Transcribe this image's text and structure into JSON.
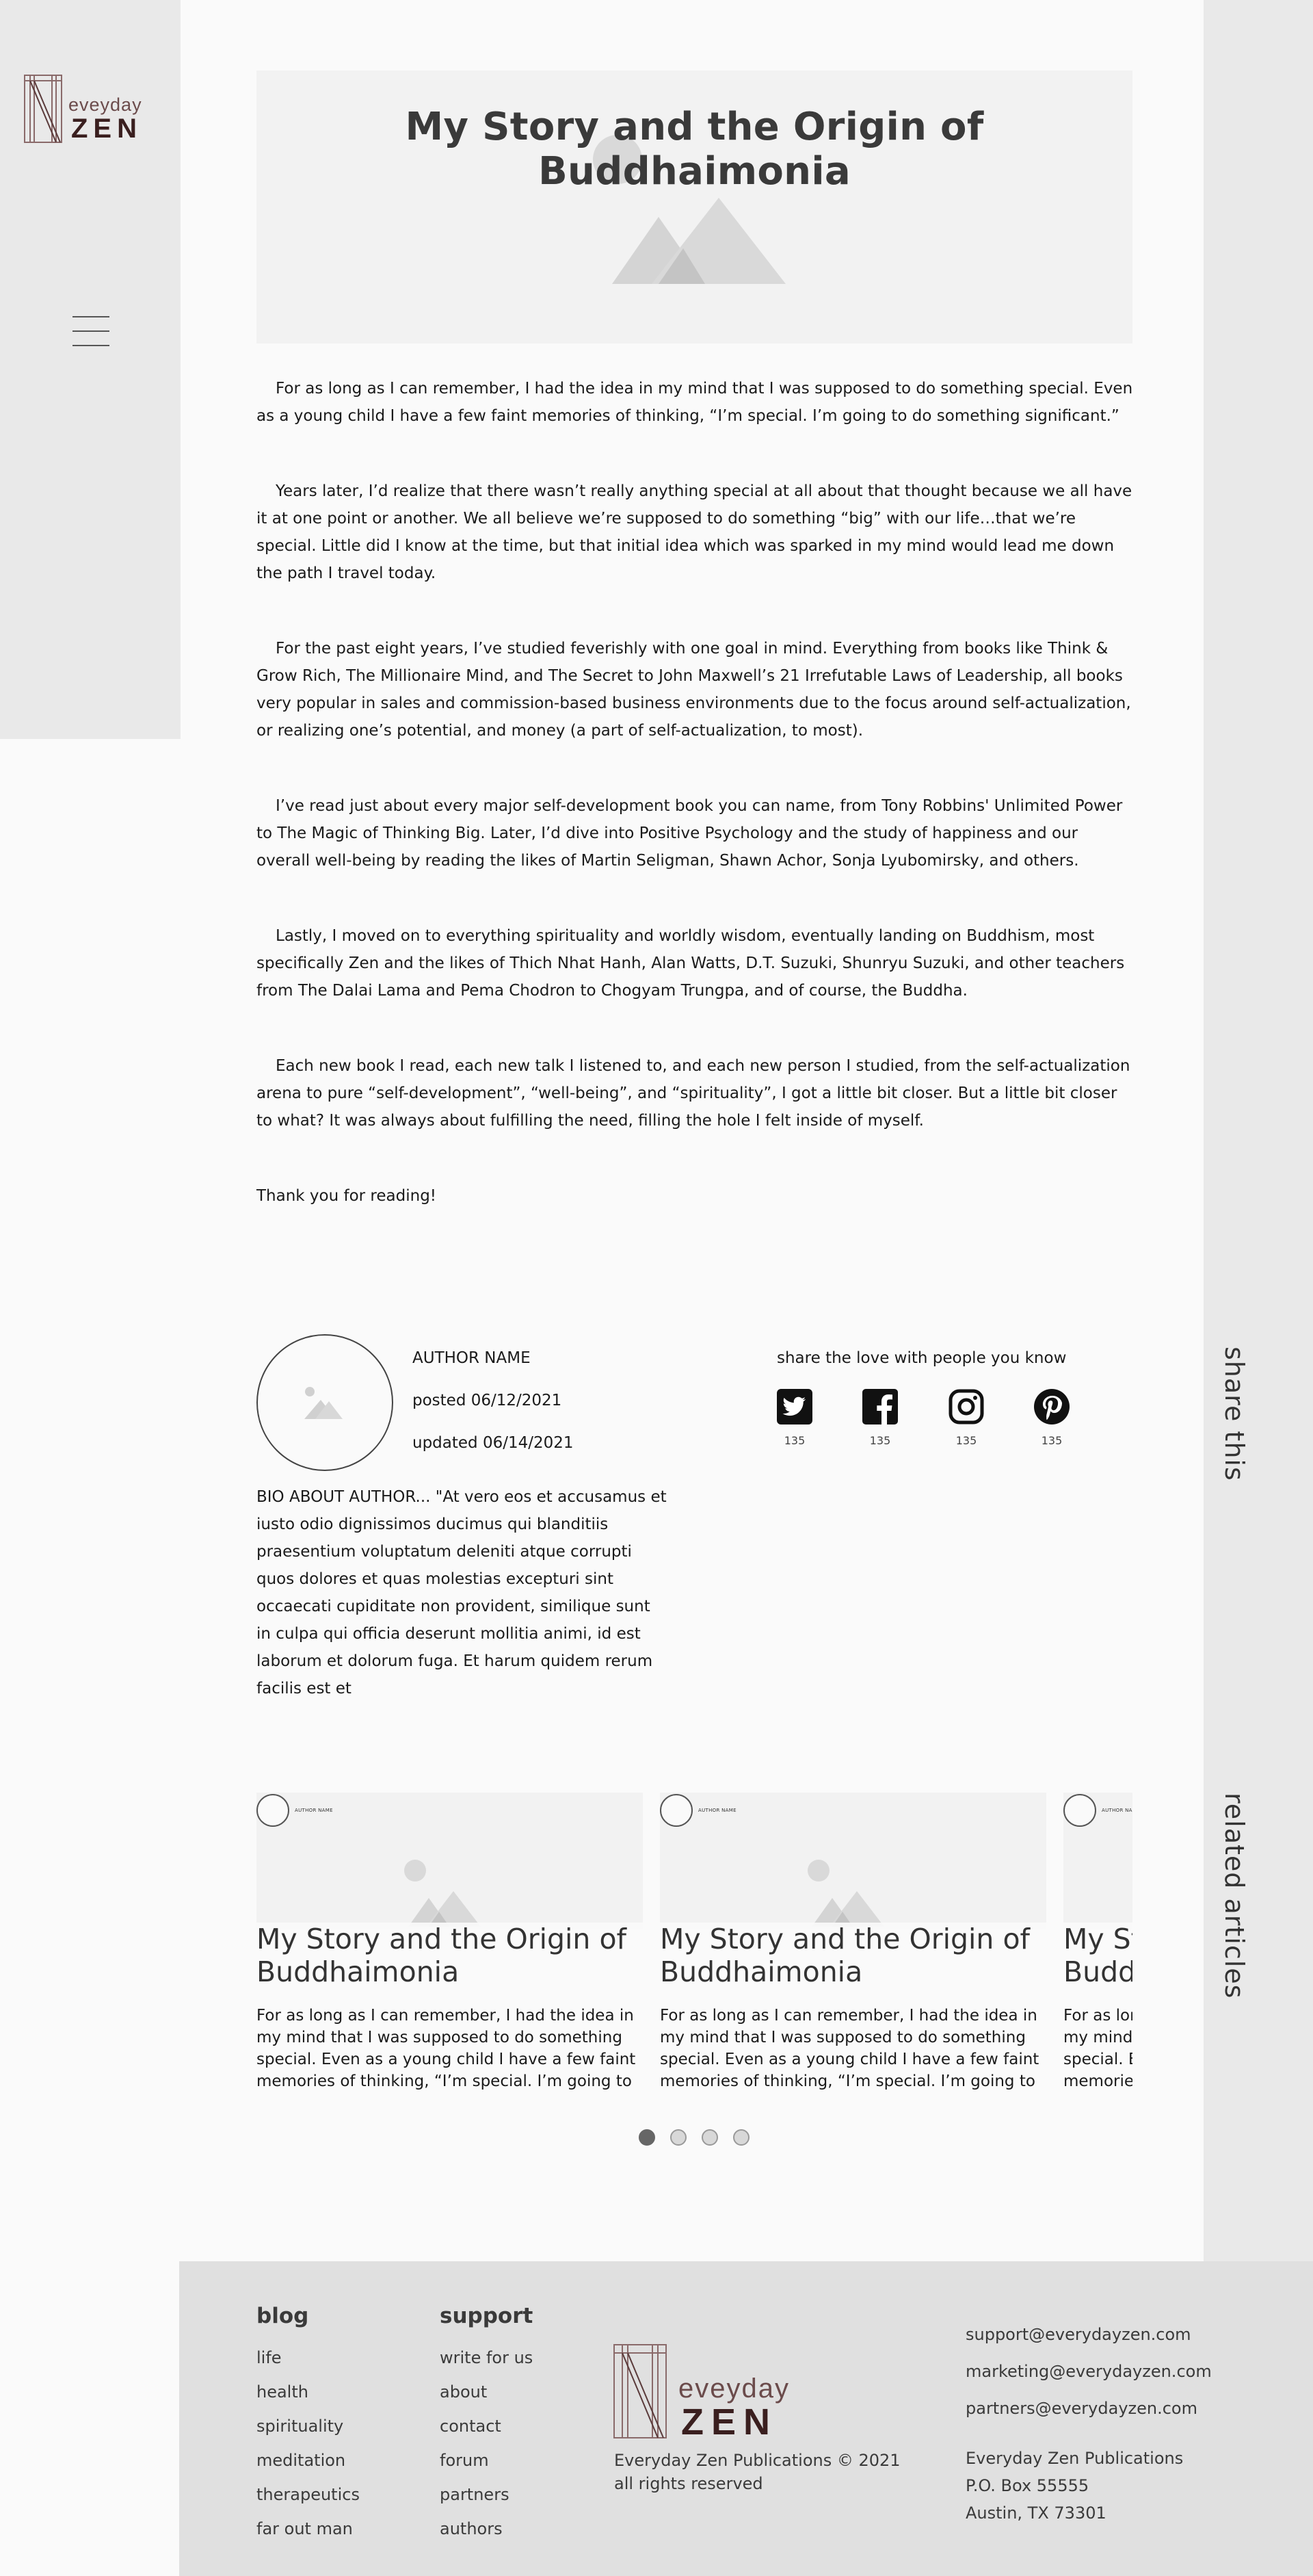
{
  "brand": {
    "logo_top": "eveyday",
    "logo_bottom": "ZEN"
  },
  "nav": {
    "menu_icon": "hamburger-icon"
  },
  "rail": {
    "share_label": "share this",
    "related_label": "related articles"
  },
  "article": {
    "title": "My Story and the Origin of Buddhaimonia",
    "paragraphs": [
      "For as long as I can remember, I had the idea in my mind that I was supposed to do something special. Even as a young child I have a few faint memories of thinking, “I’m special. I’m going to do something significant.”",
      "Years later, I’d realize that there wasn’t really anything special at all about that thought because we all have it at one point or another. We all believe we’re supposed to do something “big” with our life…that we’re special. Little did I know at the time, but that initial idea which was sparked in my mind would lead me down the path I travel today.",
      "For the past eight years, I’ve studied feverishly with one goal in mind. Everything from books like Think & Grow Rich, The Millionaire Mind, and The Secret to John Maxwell’s 21 Irrefutable Laws of Leadership, all books very popular in sales and commission-based business environments due to the focus around self-actualization, or realizing one’s potential, and money (a part of self-actualization, to most).",
      "I’ve read just about every major self-development book you can name, from Tony Robbins' Unlimited Power to The Magic of Thinking Big. Later, I’d dive into Positive Psychology and the study of happiness and our overall well-being by reading the likes of Martin Seligman, Shawn Achor, Sonja Lyubomirsky, and others.",
      "Lastly, I moved on to everything spirituality and worldly wisdom, eventually landing on Buddhism, most specifically Zen and the likes of Thich Nhat Hanh, Alan Watts, D.T. Suzuki, Shunryu Suzuki, and other teachers from The Dalai Lama and Pema Chodron to Chogyam Trungpa, and of course, the Buddha.",
      "Each new book I read, each new talk I listened to, and each new person I studied, from the self-actualization arena to pure “self-development”, “well-being”, and “spirituality”, I got a little bit closer. But a little bit closer to what? It was always about fulfilling the need, filling the hole I felt inside of myself."
    ],
    "closing": "Thank you for reading!"
  },
  "author": {
    "name": "AUTHOR NAME",
    "posted": "posted 06/12/2021",
    "updated": "updated 06/14/2021",
    "bio": "BIO ABOUT AUTHOR... \"At vero eos et accusamus et iusto odio dignissimos ducimus qui blanditiis praesentium voluptatum deleniti atque corrupti quos dolores et quas molestias excepturi sint occaecati cupiditate non provident, similique sunt in culpa qui officia deserunt mollitia animi, id est laborum et dolorum fuga. Et harum quidem rerum facilis est et"
  },
  "share": {
    "title": "share the love with people you know",
    "items": [
      {
        "icon": "twitter-icon",
        "count": "135"
      },
      {
        "icon": "facebook-icon",
        "count": "135"
      },
      {
        "icon": "instagram-icon",
        "count": "135"
      },
      {
        "icon": "pinterest-icon",
        "count": "135"
      }
    ]
  },
  "related": {
    "cards": [
      {
        "author": "AUTHOR NAME",
        "title": "My Story and the Origin of Buddhaimonia",
        "excerpt": "For as long as I can remember, I had the idea in my mind that I was supposed to do something special. Even as a young child I have a few faint memories of thinking, “I’m special. I’m going to"
      },
      {
        "author": "AUTHOR NAME",
        "title": "My Story and the Origin of Buddhaimonia",
        "excerpt": "For as long as I can remember, I had the idea in my mind that I was supposed to do something special. Even as a young child I have a few faint memories of thinking, “I’m special. I’m going to"
      },
      {
        "author": "AUTHOR NAME",
        "title": "My Story and the Origin of Buddhaimonia",
        "excerpt": "For as long as I can remember, I had the idea in my mind that I was supposed to do something special. Even as a young child I have a few faint memories of thinking, “I’m special. I’m going to"
      }
    ],
    "active_dot": 1,
    "dot_count": 4
  },
  "footer": {
    "blog": {
      "heading": "blog",
      "links": [
        "life",
        "health",
        "spirituality",
        "meditation",
        "therapeutics",
        "far out man"
      ]
    },
    "support": {
      "heading": "support",
      "links": [
        "write for us",
        "about",
        "contact",
        "forum",
        "partners",
        "authors"
      ]
    },
    "copyright": "Everyday Zen Publications © 2021",
    "rights": "all rights reserved",
    "emails": [
      "support@everydayzen.com",
      "marketing@everydayzen.com",
      "partners@everydayzen.com"
    ],
    "address": [
      "Everyday Zen Publications",
      "P.O. Box 55555",
      "Austin, TX 73301"
    ]
  }
}
